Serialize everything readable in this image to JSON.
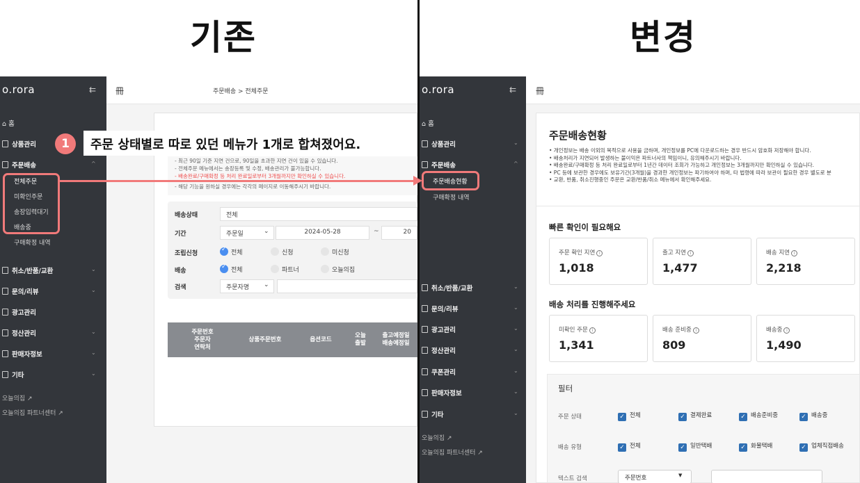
{
  "headings": {
    "before": "기존",
    "after": "변경"
  },
  "callout": {
    "number": "1",
    "text": "주문 상태별로 따로 있던 메뉴가 1개로 합쳐졌어요."
  },
  "icons": {
    "home": "home-icon",
    "store": "store-icon",
    "collapse": "collapse-sidebar-icon",
    "menu": "menu-doc-icon",
    "chevron": "chevron-icon",
    "external": "external-link-icon",
    "info": "info-icon",
    "check": "check-icon"
  },
  "colors": {
    "sidebar": "#33363b",
    "highlight": "#f17a7a",
    "checkbox": "#2f6fb3",
    "radio_on": "#4a8ef0",
    "table_header": "#888b90",
    "notice_red": "#ef4d4d"
  },
  "old": {
    "logo": "o.rora",
    "collapse_icon": "⇇",
    "nav": {
      "home": "홈",
      "products": "상품관리",
      "orders": "주문배송",
      "orders_subs": [
        "전체주문",
        "미확인주문",
        "송장입력대기",
        "배송중",
        "구매확정 내역"
      ],
      "cancel": "취소/반품/교환",
      "inquiry": "문의/리뷰",
      "ads": "광고관리",
      "settlement": "정산관리",
      "seller": "판매자정보",
      "etc": "기타"
    },
    "footer": [
      "오늘의집 ↗",
      "오늘의집 파트너센터 ↗"
    ],
    "breadcrumb": "주문배송  >  전체주문",
    "notice": {
      "line1": "- 최근 90일 기준 지연 건으로, 90일을 초과한 지연 건이 있을 수 있습니다.",
      "line2": "- 전체주문 메뉴에서는 송장등록 및 수정, 배송관리가 불가능합니다.",
      "line3": "- 배송완료/구매확정 등 처리 완료일로부터 3개월까지만 확인하실 수 있습니다.",
      "line4": "- 해당 기능을 원하실 경우에는 각각의 페이지로 이동해주시기 바랍니다."
    },
    "filters": {
      "status_label": "배송상태",
      "status_value": "전체",
      "period_label": "기간",
      "period_type": "주문일",
      "date_from": "2024-05-28",
      "date_sep": "~",
      "date_to": "20",
      "assembly_label": "조립신청",
      "assembly_opts": [
        "전체",
        "신청",
        "미신청"
      ],
      "delivery_label": "배송",
      "delivery_opts": [
        "전체",
        "파트너",
        "오늘의집"
      ],
      "search_label": "검색",
      "search_type": "주문자명"
    },
    "table_headers": {
      "col1": "주문번호\n주문자\n연락처",
      "col2": "상품주문번호",
      "col3": "옵션코드",
      "col4": "오늘\n출발",
      "col5": "출고예정일\n배송예정일"
    }
  },
  "new": {
    "logo": "o.rora",
    "collapse_icon": "⇇",
    "nav": {
      "home": "홈",
      "products": "상품관리",
      "orders": "주문배송",
      "orders_subs": [
        "주문배송현황",
        "구매확정 내역"
      ],
      "cancel": "취소/반품/교환",
      "inquiry": "문의/리뷰",
      "ads": "광고관리",
      "settlement": "정산관리",
      "coupon": "쿠폰관리",
      "seller": "판매자정보",
      "etc": "기타"
    },
    "footer": [
      "오늘의집 ↗",
      "오늘의집 파트너센터 ↗"
    ],
    "page_title": "주문배송현황",
    "bullets": [
      "• 개인정보는 배송 이외의 목적으로 사용을 금하며, 개인정보를 PC에 다운로드하는 경우 반드시 암호화 저장해야 합니다.",
      "• 배송처리가 지연되어 발생하는 불이익은 파트너사의 책임이니, 유의해주시기 바랍니다.",
      "• 배송완료/구매확정 등 처리 완료일로부터 1년간 데이터 조회가 가능하고 개인정보는 3개월까지만 확인하실 수 있습니다.",
      "• PC 등에 보관한 경우에도 보유기간(3개월)을 경과한 개인정보는 파기하여야 하며, 타 법령에 따라 보관이 필요한 경우 별도로 분",
      "• 교환, 반품, 취소진행중인 주문은 교환/반품/취소 메뉴에서 확인해주세요."
    ],
    "section1": {
      "title": "빠른 확인이 필요해요",
      "stats": [
        {
          "label": "주문 확인 지연",
          "value": "1,018"
        },
        {
          "label": "출고 지연",
          "value": "1,477"
        },
        {
          "label": "배송 지연",
          "value": "2,218"
        }
      ]
    },
    "section2": {
      "title": "배송 처리를 진행해주세요",
      "stats": [
        {
          "label": "미확인 주문",
          "value": "1,341"
        },
        {
          "label": "배송 준비중",
          "value": "809"
        },
        {
          "label": "배송중",
          "value": "1,490"
        }
      ]
    },
    "filter": {
      "title": "필터",
      "status_label": "주문 상태",
      "status_opts": [
        "전체",
        "결제완료",
        "배송준비중",
        "배송중"
      ],
      "type_label": "배송 유형",
      "type_opts": [
        "전체",
        "일반택배",
        "화물택배",
        "업체직접배송"
      ],
      "text_label": "텍스트 검색",
      "text_type": "주문번호"
    }
  }
}
